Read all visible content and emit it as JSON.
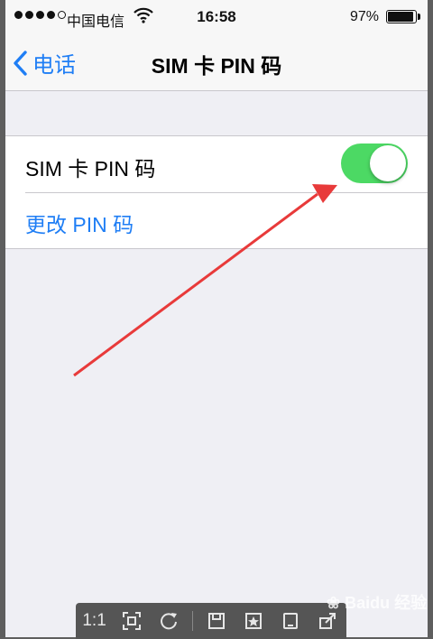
{
  "statusbar": {
    "carrier": "中国电信",
    "time": "16:58",
    "battery_pct": "97%",
    "battery_level": 0.97
  },
  "navbar": {
    "back_label": "电话",
    "title": "SIM 卡 PIN 码"
  },
  "settings": {
    "sim_pin_label": "SIM 卡 PIN 码",
    "sim_pin_enabled": true,
    "change_pin_label": "更改 PIN 码"
  },
  "viewer_toolbar": {
    "actual_size_label": "1:1",
    "icons": [
      "fit-screen-icon",
      "rotate-icon",
      "save-icon",
      "favorite-icon",
      "tablet-icon",
      "share-icon"
    ]
  },
  "watermark": {
    "text": "Baidu 经验"
  },
  "colors": {
    "accent": "#1f7ef5",
    "toggle_on": "#4cd964",
    "background": "#efeff4",
    "annotation_arrow": "#e83a3a"
  }
}
